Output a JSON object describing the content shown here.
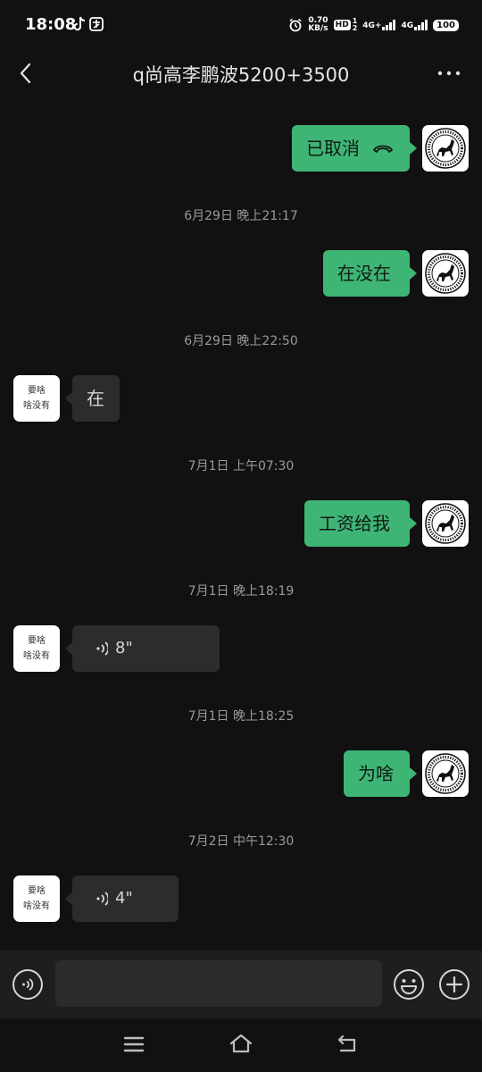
{
  "status_bar": {
    "time": "18:08",
    "net_speed_value": "0.70",
    "net_speed_unit": "KB/s",
    "hd_badge": "HD",
    "hd_sim": "1",
    "hd_sim2": "2",
    "signal1_label": "4G+",
    "signal2_label": "4G",
    "battery": "100",
    "icons": [
      "tiktok-icon",
      "app-icon",
      "alarm-icon",
      "hd-icon",
      "signal-icon",
      "battery-icon"
    ]
  },
  "header": {
    "title": "q尚高李鹏波5200+3500",
    "back_icon": "back-arrow-icon",
    "more_icon": "more-dots-icon"
  },
  "contact_avatar": {
    "line1": "要啥",
    "line2": "啥没有"
  },
  "messages": [
    {
      "type": "call",
      "direction": "out",
      "text": "已取消",
      "icon": "phone-hangup-icon"
    },
    {
      "type": "timestamp",
      "text": "6月29日 晚上21:17"
    },
    {
      "type": "text",
      "direction": "out",
      "text": "在没在"
    },
    {
      "type": "timestamp",
      "text": "6月29日 晚上22:50"
    },
    {
      "type": "text",
      "direction": "in",
      "text": "在"
    },
    {
      "type": "timestamp",
      "text": "7月1日 上午07:30"
    },
    {
      "type": "text",
      "direction": "out",
      "text": "工资给我"
    },
    {
      "type": "timestamp",
      "text": "7月1日 晚上18:19"
    },
    {
      "type": "voice",
      "direction": "in",
      "duration": "8\""
    },
    {
      "type": "timestamp",
      "text": "7月1日 晚上18:25"
    },
    {
      "type": "text",
      "direction": "out",
      "text": "为啥"
    },
    {
      "type": "timestamp",
      "text": "7月2日 中午12:30"
    },
    {
      "type": "voice",
      "direction": "in",
      "duration": "4\""
    }
  ],
  "input_bar": {
    "value": "",
    "placeholder": "",
    "voice_icon": "voice-input-icon",
    "emoji_icon": "emoji-icon",
    "plus_icon": "plus-icon"
  },
  "nav_bar": {
    "icons": [
      "menu-icon",
      "home-icon",
      "back-icon"
    ]
  },
  "colors": {
    "background": "#111111",
    "outgoing_bubble": "#3eb575",
    "incoming_bubble": "#2c2c2c",
    "timestamp_text": "#9a9a9a",
    "input_bar": "#1e1e1e"
  }
}
